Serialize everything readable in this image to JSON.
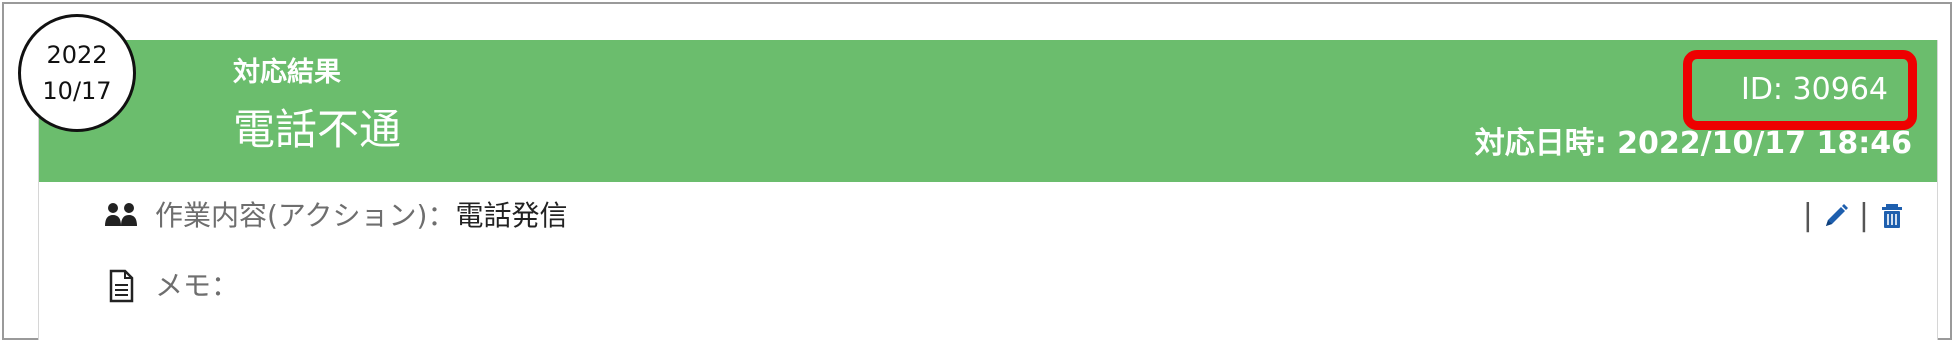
{
  "date": {
    "year": "2022",
    "month_day": "10/17"
  },
  "header": {
    "small_title": "対応結果",
    "main_title": "電話不通",
    "id_text": "ID: 30964",
    "datetime_text": "対応日時: 2022/10/17 18:46"
  },
  "details": {
    "action_label": "作業内容(アクション)：",
    "action_value": "電話発信",
    "memo_label": "メモ：",
    "memo_value": ""
  },
  "actions": {
    "separator": "|"
  },
  "icons": {
    "people": "people-icon",
    "document": "document-icon",
    "edit": "pencil-icon",
    "delete": "trash-icon"
  },
  "colors": {
    "header_bg": "#6bbd6d",
    "highlight": "#ee0000",
    "icon_blue": "#1e5fae"
  }
}
